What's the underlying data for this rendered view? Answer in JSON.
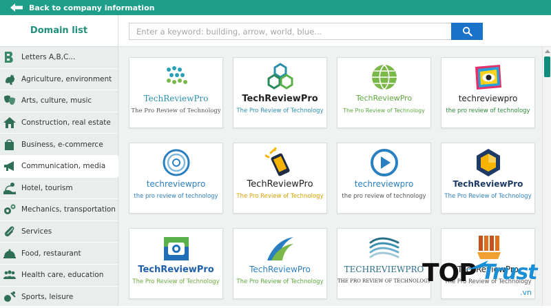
{
  "topbar": {
    "back_label": "Back to company information"
  },
  "sidebar": {
    "title": "Domain list",
    "items": [
      {
        "label": "Letters A,B,C...",
        "icon": "letter-b-icon"
      },
      {
        "label": "Agriculture, environment",
        "icon": "rooster-icon"
      },
      {
        "label": "Arts, culture, music",
        "icon": "theater-masks-icon"
      },
      {
        "label": "Construction, real estate",
        "icon": "house-icon"
      },
      {
        "label": "Business, e-commerce",
        "icon": "shopping-bag-icon"
      },
      {
        "label": "Communication, media",
        "icon": "megaphone-icon"
      },
      {
        "label": "Hotel, tourism",
        "icon": "beach-icon"
      },
      {
        "label": "Mechanics, transportation",
        "icon": "gears-icon"
      },
      {
        "label": "Services",
        "icon": "paperclip-icon"
      },
      {
        "label": "Food, restaurant",
        "icon": "cloche-icon"
      },
      {
        "label": "Health care, education",
        "icon": "people-icon"
      },
      {
        "label": "Sports, leisure",
        "icon": "sports-icon"
      }
    ],
    "active_index": 5
  },
  "search": {
    "placeholder": "Enter a keyword: building, arrow, world, blue...",
    "button_icon": "search-icon"
  },
  "logos": [
    {
      "brand": "TechReviewPro",
      "tagline": "The Pro Review of Technology",
      "icon": "dots-cluster-icon",
      "brand_color": "#2a8fb0",
      "tag_color": "#555555"
    },
    {
      "brand": "TechReviewPro",
      "tagline": "The Pro Review of Technology",
      "icon": "hexagon-links-icon",
      "brand_color": "#222222",
      "tag_color": "#2a8fb0"
    },
    {
      "brand": "TechReviewPro",
      "tagline": "The Pro Review of Technology",
      "icon": "green-globe-icon",
      "brand_color": "#5aa83a",
      "tag_color": "#5aa83a"
    },
    {
      "brand": "techreviewpro",
      "tagline": "the pro review of technology",
      "icon": "eye-frame-icon",
      "brand_color": "#222222",
      "tag_color": "#2a8a3a"
    },
    {
      "brand": "techreviewpro",
      "tagline": "the pro review of technology",
      "icon": "spiral-icon",
      "brand_color": "#2a7fc1",
      "tag_color": "#2a7fc1"
    },
    {
      "brand": "TechReviewPro",
      "tagline": "The Pro Review of Technology",
      "icon": "phone-icon",
      "brand_color": "#222222",
      "tag_color": "#d9a000"
    },
    {
      "brand": "techreviewpro",
      "tagline": "the pro review of technology",
      "icon": "play-button-icon",
      "brand_color": "#2a7fc1",
      "tag_color": "#555555"
    },
    {
      "brand": "TechReviewPro",
      "tagline": "The Pro Review of Technology",
      "icon": "hexagon-badge-icon",
      "brand_color": "#1d3b66",
      "tag_color": "#2a7fc1"
    },
    {
      "brand": "TechReviewPro",
      "tagline": "The Pro Review of Technology",
      "icon": "camera-icon",
      "brand_color": "#1f5fa8",
      "tag_color": "#6aa83a"
    },
    {
      "brand": "TechReviewPro",
      "tagline": "The Pro Review of Technology",
      "icon": "swoosh-icon",
      "brand_color": "#2a7fc1",
      "tag_color": "#5aa83a"
    },
    {
      "brand": "TECHREVIEWPRO",
      "tagline": "THE PRO REVIEW OF TECHNOLOGY",
      "icon": "waves-icon",
      "brand_color": "#2a6f8a",
      "tag_color": "#333333"
    },
    {
      "brand": "TechReviewPro",
      "tagline": "The Pro Review of Technology",
      "icon": "blocks-icon",
      "brand_color": "#222222",
      "tag_color": "#555555"
    }
  ],
  "watermark": {
    "top": "TOP",
    "trust": "Trust",
    "vn": ".vn"
  },
  "colors": {
    "accent": "#1f9e8a",
    "search_button": "#1a73c9",
    "sidebar_bg": "#e9eeec"
  }
}
